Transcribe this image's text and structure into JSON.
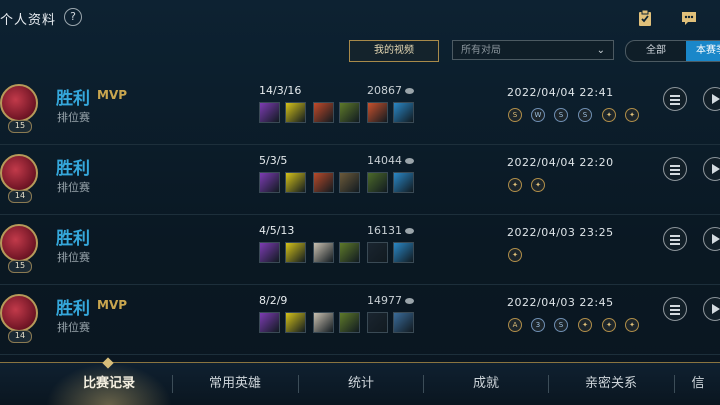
{
  "header": {
    "title": "个人资料",
    "help_symbol": "?"
  },
  "filters": {
    "my_videos": "我的视频",
    "match_filter": "所有对局",
    "segments": [
      "全部",
      "本赛季"
    ]
  },
  "matches": [
    {
      "result": "胜利",
      "mvp": "MVP",
      "mode": "排位赛",
      "level": "15",
      "kda": "14/3/16",
      "gold": "20867",
      "date": "2022/04/04 22:41",
      "items": [
        "#7d3cb3",
        "#d4c21a",
        "#c24a2a",
        "#5e7a2a",
        "#c8512d",
        "#2a87c6"
      ],
      "badges": [
        {
          "c": "gold",
          "t": "S"
        },
        {
          "c": "blue",
          "t": "W"
        },
        {
          "c": "blue",
          "t": "S"
        },
        {
          "c": "blue",
          "t": "S"
        },
        {
          "c": "gold",
          "t": "✦"
        },
        {
          "c": "gold",
          "t": "✦"
        }
      ]
    },
    {
      "result": "胜利",
      "mvp": "",
      "mode": "排位赛",
      "level": "14",
      "kda": "5/3/5",
      "gold": "14044",
      "date": "2022/04/04 22:20",
      "items": [
        "#7d3cb3",
        "#d4c21a",
        "#b74a2a",
        "#6c5a3a",
        "#4c6a2a",
        "#2a87c6"
      ],
      "badges": [
        {
          "c": "gold",
          "t": "✦"
        },
        {
          "c": "gold",
          "t": "✦"
        }
      ]
    },
    {
      "result": "胜利",
      "mvp": "",
      "mode": "排位赛",
      "level": "15",
      "kda": "4/5/13",
      "gold": "16131",
      "date": "2022/04/03 23:25",
      "items": [
        "#7d3cb3",
        "#d4c21a",
        "#c9c0b0",
        "#5e7a2a",
        "#1a2530",
        "#2a87c6"
      ],
      "badges": [
        {
          "c": "gold",
          "t": "✦"
        }
      ]
    },
    {
      "result": "胜利",
      "mvp": "MVP",
      "mode": "排位赛",
      "level": "14",
      "kda": "8/2/9",
      "gold": "14977",
      "date": "2022/04/03 22:45",
      "items": [
        "#7d3cb3",
        "#d4c21a",
        "#c9c0b0",
        "#5e7a2a",
        "#1a2530",
        "#3a6c9a"
      ],
      "badges": [
        {
          "c": "gold",
          "t": "A"
        },
        {
          "c": "blue",
          "t": "3"
        },
        {
          "c": "blue",
          "t": "S"
        },
        {
          "c": "gold",
          "t": "✦"
        },
        {
          "c": "gold",
          "t": "✦"
        },
        {
          "c": "gold",
          "t": "✦"
        }
      ]
    }
  ],
  "nav": {
    "tabs": [
      "比赛记录",
      "常用英雄",
      "统计",
      "成就",
      "亲密关系",
      "信"
    ],
    "active_index": 0
  }
}
